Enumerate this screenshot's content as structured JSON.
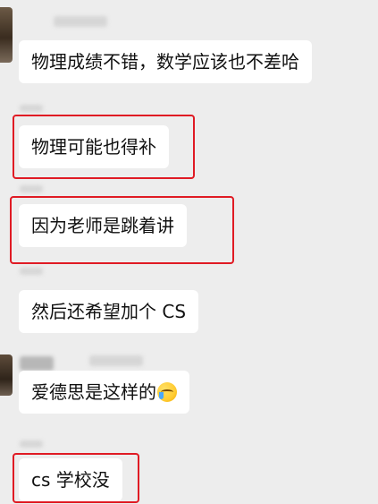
{
  "chat": {
    "messages": [
      {
        "text": "物理成绩不错，数学应该也不差哈"
      },
      {
        "text": "物理可能也得补"
      },
      {
        "text": "因为老师是跳着讲"
      },
      {
        "text": "然后还希望加个 CS"
      },
      {
        "text": "爱德思是这样的"
      },
      {
        "text": "cs 学校没"
      }
    ],
    "emoji_icon": "face-with-tears-of-joy-icon",
    "highlight_color": "#e01b24",
    "background_color": "#ededed"
  }
}
